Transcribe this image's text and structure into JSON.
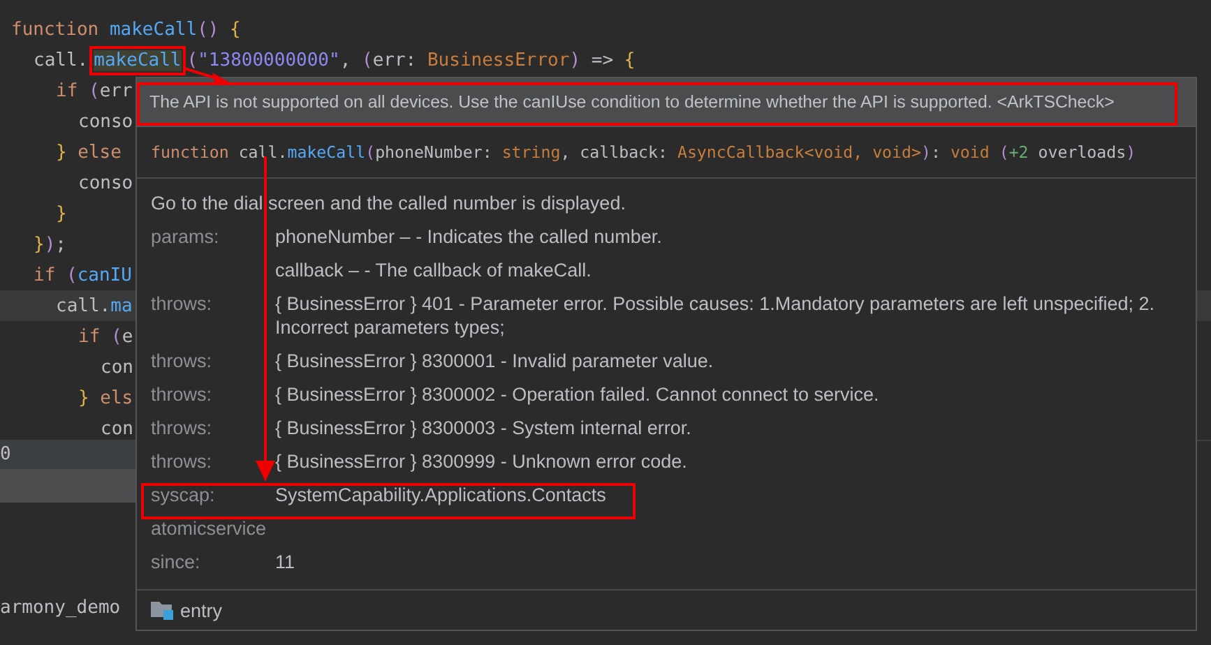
{
  "editor": {
    "lines": [
      {
        "tokens": [
          {
            "kind": "kw",
            "text": "function "
          },
          {
            "kind": "fn",
            "text": "makeCall"
          },
          {
            "kind": "paren",
            "text": "()"
          },
          {
            "kind": "brace",
            "text": " {"
          }
        ],
        "children": [
          {
            "tokens": [
              {
                "kind": "plain",
                "text": "call."
              },
              {
                "kind": "fn",
                "text": "makeCall",
                "highlighted": true
              },
              {
                "kind": "paren",
                "text": "("
              },
              {
                "kind": "str",
                "text": "\"13800000000\""
              },
              {
                "kind": "plain",
                "text": ", "
              },
              {
                "kind": "paren",
                "text": "("
              },
              {
                "kind": "plain",
                "text": "err: "
              },
              {
                "kind": "type",
                "text": "BusinessError"
              },
              {
                "kind": "paren",
                "text": ")"
              },
              {
                "kind": "plain",
                "text": " => "
              },
              {
                "kind": "brace",
                "text": "{"
              }
            ],
            "children": [
              {
                "tokens": [
                  {
                    "kind": "kw",
                    "text": "if "
                  },
                  {
                    "kind": "paren",
                    "text": "("
                  },
                  {
                    "kind": "plain",
                    "text": "err"
                  }
                ],
                "children": [
                  {
                    "tokens": [
                      {
                        "kind": "plain",
                        "text": "conso"
                      }
                    ]
                  }
                ]
              },
              {
                "tokens": [
                  {
                    "kind": "brace",
                    "text": "}"
                  },
                  {
                    "kind": "kw",
                    "text": " else"
                  }
                ],
                "children": [
                  {
                    "tokens": [
                      {
                        "kind": "plain",
                        "text": "conso"
                      }
                    ]
                  }
                ]
              },
              {
                "tokens": [
                  {
                    "kind": "brace",
                    "text": "}"
                  }
                ]
              }
            ]
          },
          {
            "tokens": [
              {
                "kind": "brace",
                "text": "}"
              },
              {
                "kind": "paren",
                "text": ")"
              },
              {
                "kind": "plain",
                "text": ";"
              }
            ]
          },
          {
            "tokens": [
              {
                "kind": "kw",
                "text": "if "
              },
              {
                "kind": "paren",
                "text": "("
              },
              {
                "kind": "fn",
                "text": "canIU"
              }
            ],
            "children": [
              {
                "tokens": [
                  {
                    "kind": "plain",
                    "text": "call."
                  },
                  {
                    "kind": "fn",
                    "text": "ma"
                  }
                ],
                "current": true,
                "children": [
                  {
                    "tokens": [
                      {
                        "kind": "kw",
                        "text": "if "
                      },
                      {
                        "kind": "paren",
                        "text": "("
                      },
                      {
                        "kind": "plain",
                        "text": "e"
                      }
                    ],
                    "children": [
                      {
                        "tokens": [
                          {
                            "kind": "plain",
                            "text": "con"
                          }
                        ]
                      }
                    ]
                  },
                  {
                    "tokens": [
                      {
                        "kind": "brace",
                        "text": "}"
                      },
                      {
                        "kind": "kw",
                        "text": " els"
                      }
                    ],
                    "children": [
                      {
                        "tokens": [
                          {
                            "kind": "plain",
                            "text": "con"
                          }
                        ]
                      }
                    ]
                  }
                ]
              }
            ]
          }
        ]
      }
    ]
  },
  "bottom_panel": {
    "header": "0",
    "project": "armony_demo"
  },
  "popup": {
    "warning": "The API is not supported on all devices. Use the canIUse condition to determine whether the API is supported. <ArkTSCheck>",
    "signature": [
      {
        "kind": "kw",
        "text": "function "
      },
      {
        "kind": "plain",
        "text": "call."
      },
      {
        "kind": "fn",
        "text": "makeCall"
      },
      {
        "kind": "paren",
        "text": "("
      },
      {
        "kind": "plain",
        "text": "phoneNumber: "
      },
      {
        "kind": "type",
        "text": "string"
      },
      {
        "kind": "plain",
        "text": ", callback: "
      },
      {
        "kind": "type",
        "text": "AsyncCallback<void, void>"
      },
      {
        "kind": "paren",
        "text": ")"
      },
      {
        "kind": "plain",
        "text": ": "
      },
      {
        "kind": "type",
        "text": "void"
      },
      {
        "kind": "paren",
        "text": " ("
      },
      {
        "kind": "num",
        "text": "+2"
      },
      {
        "kind": "plain",
        "text": " overloads"
      },
      {
        "kind": "paren",
        "text": ")"
      }
    ],
    "description": "Go to the dial screen and the called number is displayed.",
    "rows": [
      {
        "label": "params:",
        "value": "phoneNumber – - Indicates the called number."
      },
      {
        "value": "callback – - The callback of makeCall."
      },
      {
        "label": "throws:",
        "value": "{ BusinessError } 401 - Parameter error. Possible causes: 1.Mandatory parameters are left unspecified; 2. Incorrect parameters types;"
      },
      {
        "label": "throws:",
        "value": "{ BusinessError } 8300001 - Invalid parameter value."
      },
      {
        "label": "throws:",
        "value": "{ BusinessError } 8300002 - Operation failed. Cannot connect to service."
      },
      {
        "label": "throws:",
        "value": "{ BusinessError } 8300003 - System internal error."
      },
      {
        "label": "throws:",
        "value": "{ BusinessError } 8300999 - Unknown error code."
      },
      {
        "label": "syscap:",
        "value": "SystemCapability.Applications.Contacts"
      },
      {
        "label": "atomicservice"
      },
      {
        "label": "since:",
        "value": "11"
      }
    ],
    "module": "entry"
  }
}
